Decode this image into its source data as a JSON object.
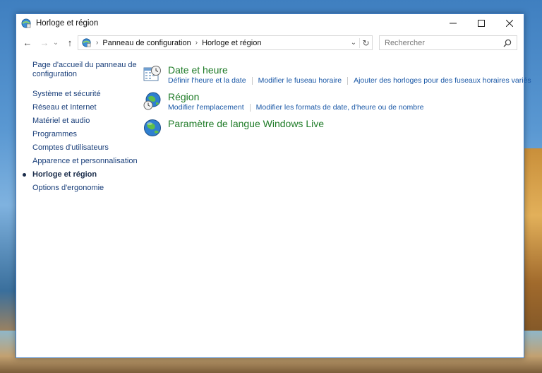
{
  "window": {
    "title": "Horloge et région",
    "controls": {
      "minimize": "—",
      "maximize": "☐",
      "close": "✕"
    }
  },
  "navigation": {
    "back": "←",
    "forward": "→",
    "recent": "⌄",
    "up": "↑"
  },
  "address": {
    "crumbs": [
      "Panneau de configuration",
      "Horloge et région"
    ],
    "separator": "›",
    "dropdown": "⌄",
    "refresh": "↻"
  },
  "search": {
    "placeholder": "Rechercher"
  },
  "sidebar": {
    "home": "Page d'accueil du panneau de configuration",
    "items": [
      {
        "label": "Système et sécurité"
      },
      {
        "label": "Réseau et Internet"
      },
      {
        "label": "Matériel et audio"
      },
      {
        "label": "Programmes"
      },
      {
        "label": "Comptes d'utilisateurs"
      },
      {
        "label": "Apparence et personnalisation"
      },
      {
        "label": "Horloge et région"
      },
      {
        "label": "Options d'ergonomie"
      }
    ]
  },
  "categories": [
    {
      "title": "Date et heure",
      "icon": "calendar-clock-icon",
      "links": [
        "Définir l'heure et la date",
        "Modifier le fuseau horaire",
        "Ajouter des horloges pour des fuseaux horaires variés"
      ]
    },
    {
      "title": "Région",
      "icon": "globe-clock-icon",
      "links": [
        "Modifier l'emplacement",
        "Modifier les formats de date, d'heure ou de nombre"
      ]
    },
    {
      "title": "Paramètre de langue Windows Live",
      "icon": "globe-icon",
      "links": []
    }
  ],
  "colors": {
    "category_title": "#1e7b27",
    "link": "#1957a6",
    "nav": "#1a3f7a",
    "window_border": "#3d7cc4"
  }
}
